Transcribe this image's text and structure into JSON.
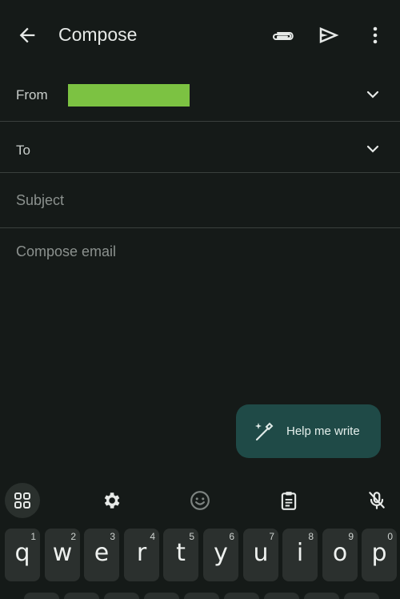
{
  "appbar": {
    "title": "Compose",
    "icons": [
      "arrow-back-icon",
      "attach-icon",
      "send-icon",
      "more-vert-icon"
    ]
  },
  "from": {
    "label": "From"
  },
  "to": {
    "label": "To"
  },
  "subject": {
    "placeholder": "Subject"
  },
  "body": {
    "placeholder": "Compose email"
  },
  "fab": {
    "label": "Help me write"
  },
  "keyboard": {
    "toolbar_icons": [
      "apps-grid-icon",
      "gear-icon",
      "emoji-icon",
      "clipboard-icon",
      "mic-off-icon"
    ],
    "row1": [
      {
        "key": "q",
        "hint": "1"
      },
      {
        "key": "w",
        "hint": "2"
      },
      {
        "key": "e",
        "hint": "3"
      },
      {
        "key": "r",
        "hint": "4"
      },
      {
        "key": "t",
        "hint": "5"
      },
      {
        "key": "y",
        "hint": "6"
      },
      {
        "key": "u",
        "hint": "7"
      },
      {
        "key": "i",
        "hint": "8"
      },
      {
        "key": "o",
        "hint": "9"
      },
      {
        "key": "p",
        "hint": "0"
      }
    ]
  },
  "colors": {
    "background": "#151a18",
    "fab_background": "#1f4a47",
    "key_background": "#2b302e",
    "redaction": "#7cc242"
  }
}
